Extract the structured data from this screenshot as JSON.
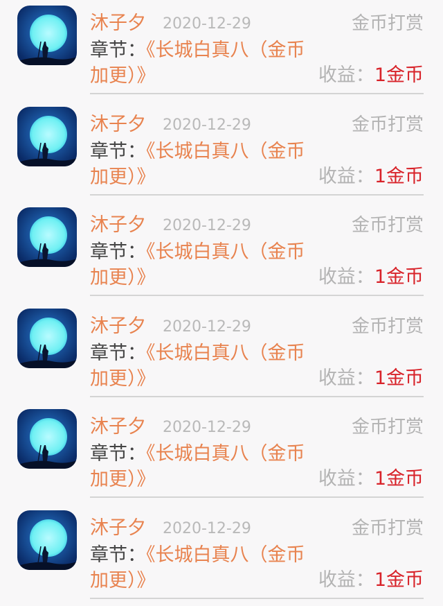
{
  "rewards": [
    {
      "name": "沐子夕",
      "date": "2020-12-29",
      "type": "金币打赏",
      "chapter_label": "章节：",
      "chapter_title": "《长城白真八（金币加更）》",
      "income_label": "收益：",
      "income_value": "1金币"
    },
    {
      "name": "沐子夕",
      "date": "2020-12-29",
      "type": "金币打赏",
      "chapter_label": "章节：",
      "chapter_title": "《长城白真八（金币加更）》",
      "income_label": "收益：",
      "income_value": "1金币"
    },
    {
      "name": "沐子夕",
      "date": "2020-12-29",
      "type": "金币打赏",
      "chapter_label": "章节：",
      "chapter_title": "《长城白真八（金币加更）》",
      "income_label": "收益：",
      "income_value": "1金币"
    },
    {
      "name": "沐子夕",
      "date": "2020-12-29",
      "type": "金币打赏",
      "chapter_label": "章节：",
      "chapter_title": "《长城白真八（金币加更）》",
      "income_label": "收益：",
      "income_value": "1金币"
    },
    {
      "name": "沐子夕",
      "date": "2020-12-29",
      "type": "金币打赏",
      "chapter_label": "章节：",
      "chapter_title": "《长城白真八（金币加更）》",
      "income_label": "收益：",
      "income_value": "1金币"
    },
    {
      "name": "沐子夕",
      "date": "2020-12-29",
      "type": "金币打赏",
      "chapter_label": "章节：",
      "chapter_title": "《长城白真八（金币加更）》",
      "income_label": "收益：",
      "income_value": "1金币"
    }
  ],
  "avatar_icon": "moon-night-avatar-icon",
  "colors": {
    "name": "#e8834f",
    "chapter_title": "#e8834f",
    "muted": "#b3b3b3",
    "income_value": "#d8232a",
    "background": "#f8f7f8"
  }
}
